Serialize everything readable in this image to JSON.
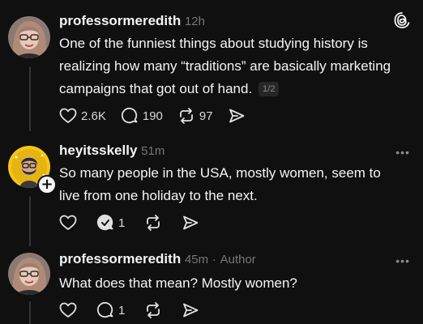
{
  "posts": [
    {
      "username": "professormeredith",
      "time": "12h",
      "text": "One of the funniest things about studying history is realizing how many “traditions” are basically marketing campaigns that got out of hand.",
      "page_indicator": "1/2",
      "likes": "2.6K",
      "replies": "190",
      "reposts": "97"
    },
    {
      "username": "heyitsskelly",
      "time": "51m",
      "text": "So many people in the USA, mostly women, seem to live from one holiday to the next.",
      "replies": "1",
      "more": "•••"
    },
    {
      "username": "professormeredith",
      "time": "45m",
      "separator": "·",
      "author_tag": "Author",
      "text": "What does that mean? Mostly women?",
      "replies": "1",
      "more": "•••"
    }
  ],
  "colors": {
    "background": "#101010",
    "text": "#f3f5f7",
    "muted": "#777777"
  }
}
